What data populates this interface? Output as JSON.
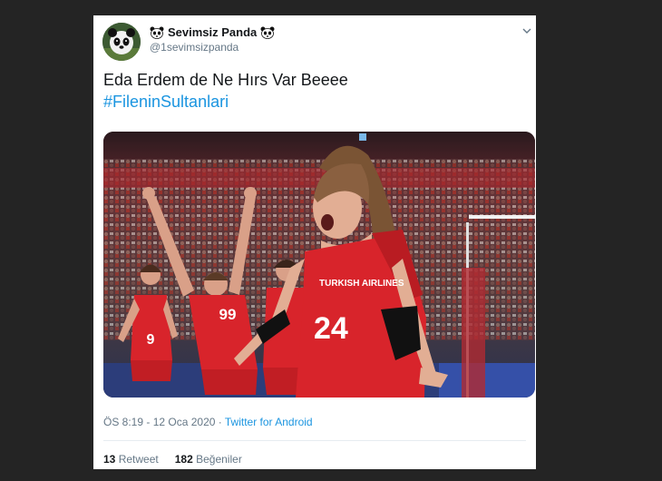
{
  "tweet": {
    "author": {
      "display_name": "Sevimsiz Panda",
      "handle": "@1sevimsizpanda",
      "name_emoji": "panda-icon"
    },
    "text": "Eda Erdem de Ne Hırs Var Beeee",
    "hashtag": "#FileninSultanlari",
    "media": {
      "type": "photo",
      "player_number_main": "24",
      "player_number_back": "99",
      "player_number_left": "9",
      "jersey_text": "TURKISH AIRLINES"
    },
    "timestamp": "ÖS 8:19 - 12 Oca 2020",
    "separator": " · ",
    "source": "Twitter for Android",
    "stats": {
      "retweets_count": "13",
      "retweets_label": "Retweet",
      "likes_count": "182",
      "likes_label": "Beğeniler"
    }
  },
  "colors": {
    "background": "#242424",
    "card": "#ffffff",
    "link": "#1b95e0",
    "muted": "#657786",
    "text": "#14171a",
    "jersey_red": "#d8242b"
  }
}
